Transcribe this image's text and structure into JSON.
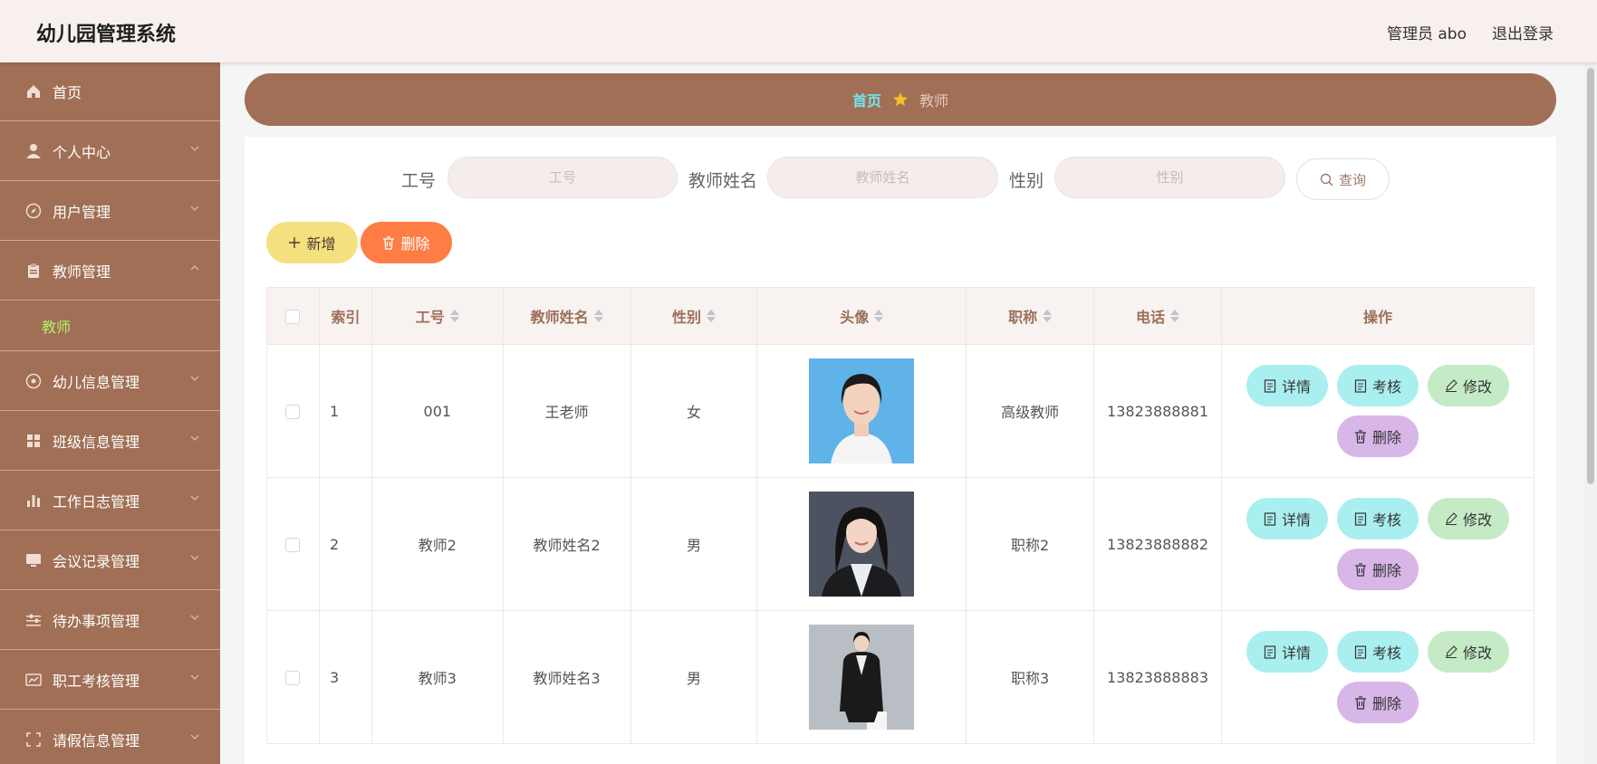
{
  "header": {
    "title": "幼儿园管理系统",
    "user": "管理员 abo",
    "logout": "退出登录"
  },
  "sidebar": {
    "items": [
      {
        "label": "首页",
        "icon": "home-icon"
      },
      {
        "label": "个人中心",
        "icon": "user-icon"
      },
      {
        "label": "用户管理",
        "icon": "compass-icon"
      },
      {
        "label": "教师管理",
        "icon": "clipboard-icon",
        "expanded": true
      },
      {
        "label": "幼儿信息管理",
        "icon": "dial-icon"
      },
      {
        "label": "班级信息管理",
        "icon": "grid-icon"
      },
      {
        "label": "工作日志管理",
        "icon": "bar-chart-icon"
      },
      {
        "label": "会议记录管理",
        "icon": "monitor-icon"
      },
      {
        "label": "待办事项管理",
        "icon": "sliders-icon"
      },
      {
        "label": "职工考核管理",
        "icon": "chart-board-icon"
      },
      {
        "label": "请假信息管理",
        "icon": "frame-icon"
      }
    ],
    "submenu": "教师"
  },
  "breadcrumb": {
    "home": "首页",
    "current": "教师"
  },
  "search": {
    "fields": [
      {
        "label": "工号",
        "placeholder": "工号"
      },
      {
        "label": "教师姓名",
        "placeholder": "教师姓名"
      },
      {
        "label": "性别",
        "placeholder": "性别"
      }
    ],
    "query_label": "查询"
  },
  "actions": {
    "add_label": "新增",
    "delete_label": "删除"
  },
  "table": {
    "columns": [
      "索引",
      "工号",
      "教师姓名",
      "性别",
      "头像",
      "职称",
      "电话",
      "操作"
    ],
    "rows": [
      {
        "index": "1",
        "id": "001",
        "name": "王老师",
        "gender": "女",
        "title": "高级教师",
        "phone": "13823888881"
      },
      {
        "index": "2",
        "id": "教师2",
        "name": "教师姓名2",
        "gender": "男",
        "title": "职称2",
        "phone": "13823888882"
      },
      {
        "index": "3",
        "id": "教师3",
        "name": "教师姓名3",
        "gender": "男",
        "title": "职称3",
        "phone": "13823888883"
      }
    ],
    "row_actions": {
      "detail": "详情",
      "check": "考核",
      "edit": "修改",
      "delete": "删除"
    }
  },
  "colors": {
    "sidebar": "#a06f55",
    "accent_cyan": "#6fe8ef",
    "submenu_green": "#b4f06d",
    "add_btn": "#f4e07f",
    "delete_btn": "#fd7d45"
  }
}
